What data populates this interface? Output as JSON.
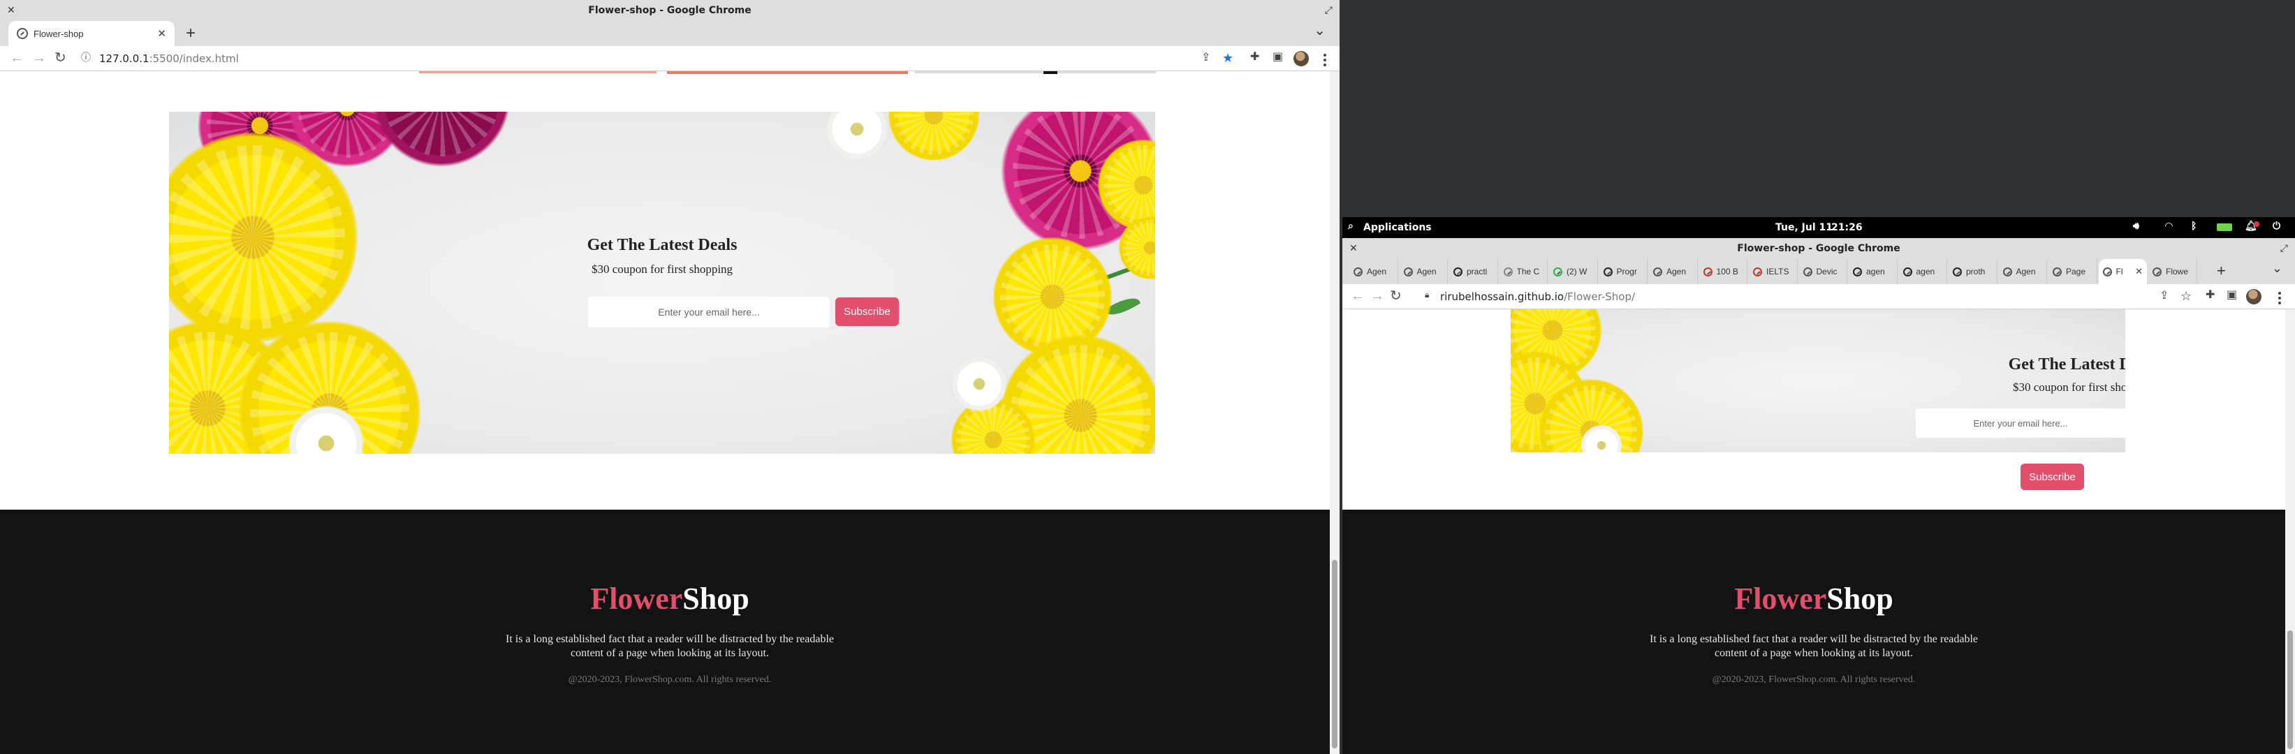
{
  "left_window": {
    "title": "Flower-shop - Google Chrome",
    "tab_label": "Flower-shop",
    "new_tab": "+",
    "tab_menu": "⌄",
    "url_host": "127.0.0.1",
    "url_path": ":5500/index.html",
    "close": "✕",
    "tab_close": "✕"
  },
  "right_window": {
    "title": "Flower-shop - Google Chrome",
    "tabs": [
      "Agen",
      "Agen",
      "practi",
      "The C",
      "(2) W",
      "Progr",
      "Agen",
      "100 B",
      "IELTS",
      "Devic",
      "agen",
      "agen",
      "proth",
      "Agen",
      "Page",
      "Fl",
      "Flowe"
    ],
    "new_tab": "+",
    "tab_menu": "⌄",
    "url_host": "rirubelhossain.github.io",
    "url_path": "/Flower-Shop/",
    "close": "✕",
    "tab_close": "✕"
  },
  "desktop_panel": {
    "applications": "Applications",
    "date": "Tue, Jul 11",
    "time": "21:26"
  },
  "site": {
    "deals_title": "Get The Latest Deals",
    "deals_subtitle": "$30 coupon for first shopping",
    "email_placeholder": "Enter your email here...",
    "subscribe_label": "Subscribe",
    "brand_part1": "Flower",
    "brand_part2": "Shop",
    "footer_line1": "It is a long established fact that a reader will be distracted by the readable",
    "footer_line2": "content of a page when looking at its layout.",
    "copyright": "@2020-2023, FlowerShop.com. All rights reserved."
  },
  "colors": {
    "accent": "#e24e6b",
    "footer_bg": "#131313",
    "desktop_bg": "#2f3132"
  },
  "icons": [
    "search-icon",
    "back-icon",
    "forward-icon",
    "reload-icon",
    "lock-icon",
    "info-icon",
    "share-icon",
    "star-icon",
    "extensions-icon",
    "sidebar-icon",
    "avatar",
    "kebab-menu-icon",
    "volume-icon",
    "wifi-icon",
    "bluetooth-icon",
    "battery-icon",
    "notification-icon",
    "power-icon"
  ]
}
